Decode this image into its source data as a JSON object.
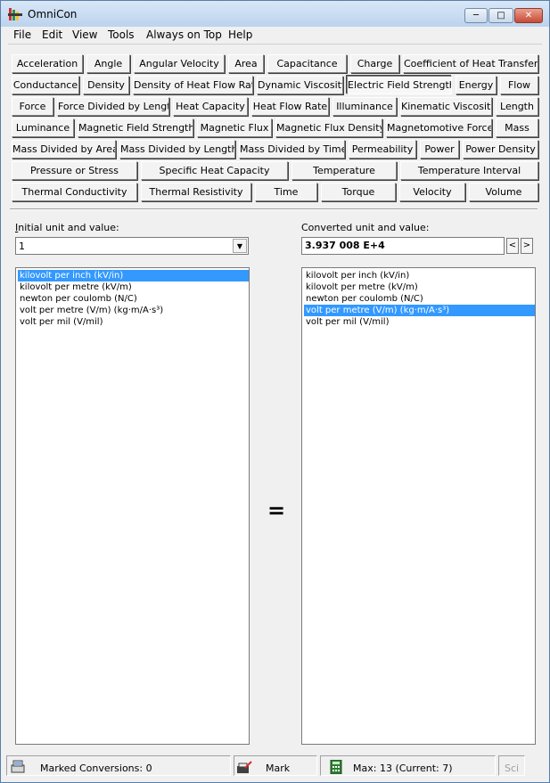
{
  "window": {
    "title": "OmniCon",
    "min_glyph": "─",
    "max_glyph": "□",
    "close_glyph": "✕"
  },
  "menu": [
    "File",
    "Edit",
    "View",
    "Tools",
    "Always on Top",
    "Help"
  ],
  "categories": {
    "rows": [
      [
        "Acceleration",
        "Angle",
        "Angular Velocity",
        "Area",
        "Capacitance",
        "Charge",
        "Coefficient of Heat Transfer"
      ],
      [
        "Conductance",
        "Density",
        "Density of Heat Flow Rate",
        "Dynamic Viscosity",
        "Electric Field Strength",
        "Energy",
        "Flow"
      ],
      [
        "Force",
        "Force Divided by Length",
        "Heat Capacity",
        "Heat Flow Rate",
        "Illuminance",
        "Kinematic Viscosity",
        "Length"
      ],
      [
        "Luminance",
        "Magnetic Field Strength",
        "Magnetic Flux",
        "Magnetic Flux Density",
        "Magnetomotive Force",
        "Mass"
      ],
      [
        "Mass Divided by Area",
        "Mass Divided by Length",
        "Mass Divided by Time",
        "Permeability",
        "Power",
        "Power Density"
      ],
      [
        "Pressure or Stress",
        "Specific Heat Capacity",
        "Temperature",
        "Temperature Interval"
      ],
      [
        "Thermal Conductivity",
        "Thermal Resistivity",
        "Time",
        "Torque",
        "Velocity",
        "Volume"
      ]
    ],
    "selected": "Electric Field Strength"
  },
  "initial": {
    "label_hotkey": "I",
    "label_rest": "nitial unit and value:",
    "value": "1"
  },
  "converted": {
    "label": "Converted unit and value:",
    "value": "3.937 008 E+4",
    "prev_glyph": "<",
    "next_glyph": ">"
  },
  "units": [
    "kilovolt per inch (kV/in)",
    "kilovolt per metre (kV/m)",
    "newton per coulomb (N/C)",
    "volt per metre (V/m) (kg·m/A·s³)",
    "volt per mil (V/mil)"
  ],
  "initial_selected_index": 0,
  "converted_selected_index": 3,
  "equals": "=",
  "status": {
    "marked": "Marked Conversions: 0",
    "mark": "Mark",
    "max": "Max: 13 (Current: 7)",
    "sci": "Sci"
  },
  "icons": [
    "app-icon",
    "marked-conversions-icon",
    "mark-icon",
    "calculator-icon",
    "combo-arrow-icon"
  ]
}
